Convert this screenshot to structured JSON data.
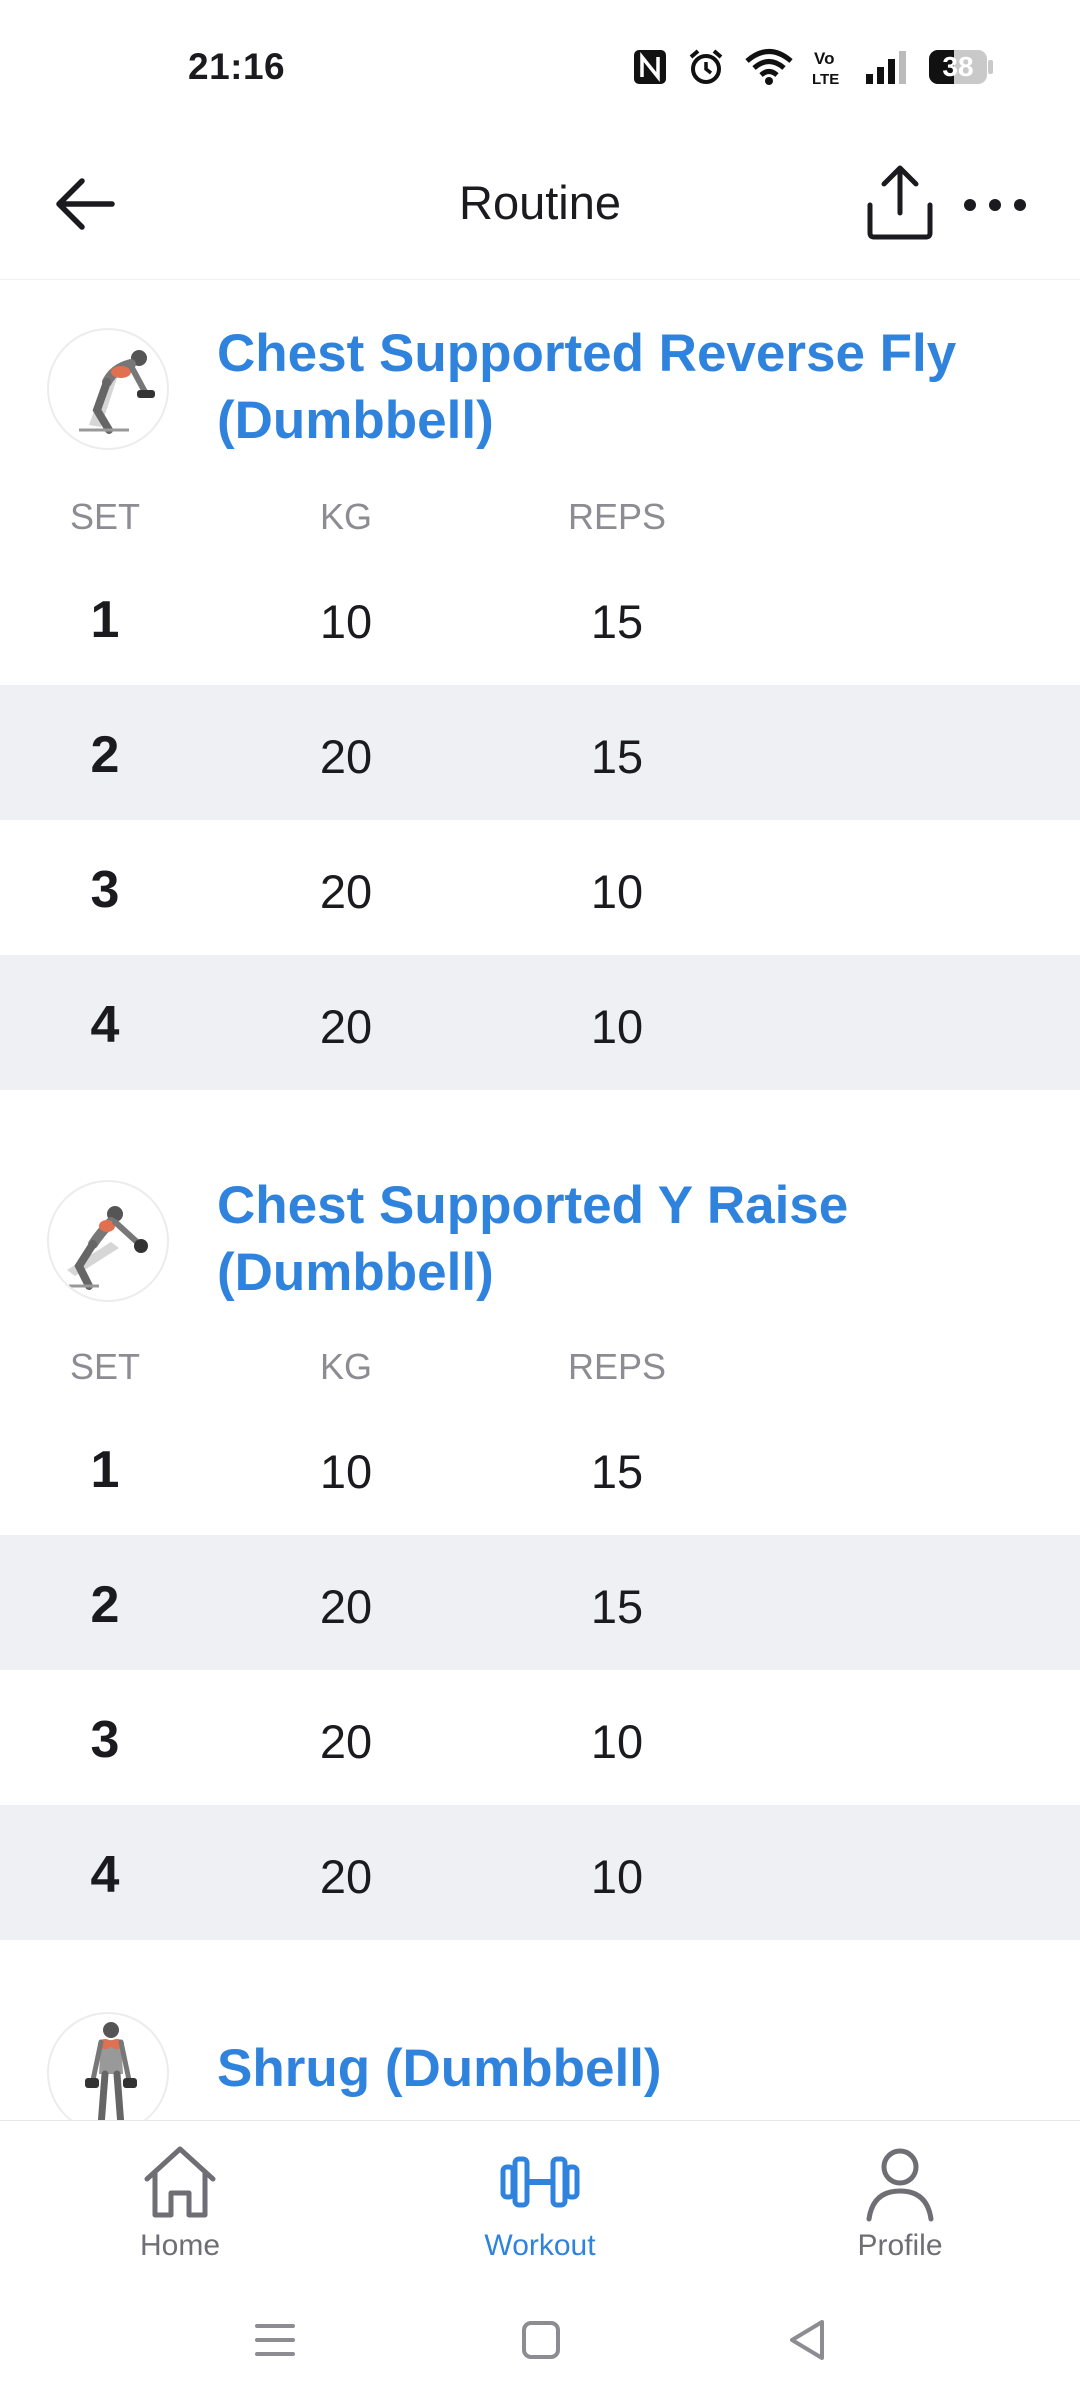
{
  "status_bar": {
    "time": "21:16",
    "battery": "38"
  },
  "header": {
    "title": "Routine"
  },
  "columns": {
    "set": "SET",
    "kg": "KG",
    "reps": "REPS"
  },
  "exercises": [
    {
      "name": "Chest Supported Reverse Fly (Dumbbell)",
      "sets": [
        {
          "set": "1",
          "kg": "10",
          "reps": "15"
        },
        {
          "set": "2",
          "kg": "20",
          "reps": "15"
        },
        {
          "set": "3",
          "kg": "20",
          "reps": "10"
        },
        {
          "set": "4",
          "kg": "20",
          "reps": "10"
        }
      ]
    },
    {
      "name": "Chest Supported Y Raise (Dumbbell)",
      "sets": [
        {
          "set": "1",
          "kg": "10",
          "reps": "15"
        },
        {
          "set": "2",
          "kg": "20",
          "reps": "15"
        },
        {
          "set": "3",
          "kg": "20",
          "reps": "10"
        },
        {
          "set": "4",
          "kg": "20",
          "reps": "10"
        }
      ]
    },
    {
      "name": "Shrug (Dumbbell)"
    }
  ],
  "bottom_nav": {
    "home": "Home",
    "workout": "Workout",
    "profile": "Profile"
  },
  "colors": {
    "accent": "#2f83dd",
    "row_alt": "#eef0f4",
    "muted": "#8c8c92"
  }
}
